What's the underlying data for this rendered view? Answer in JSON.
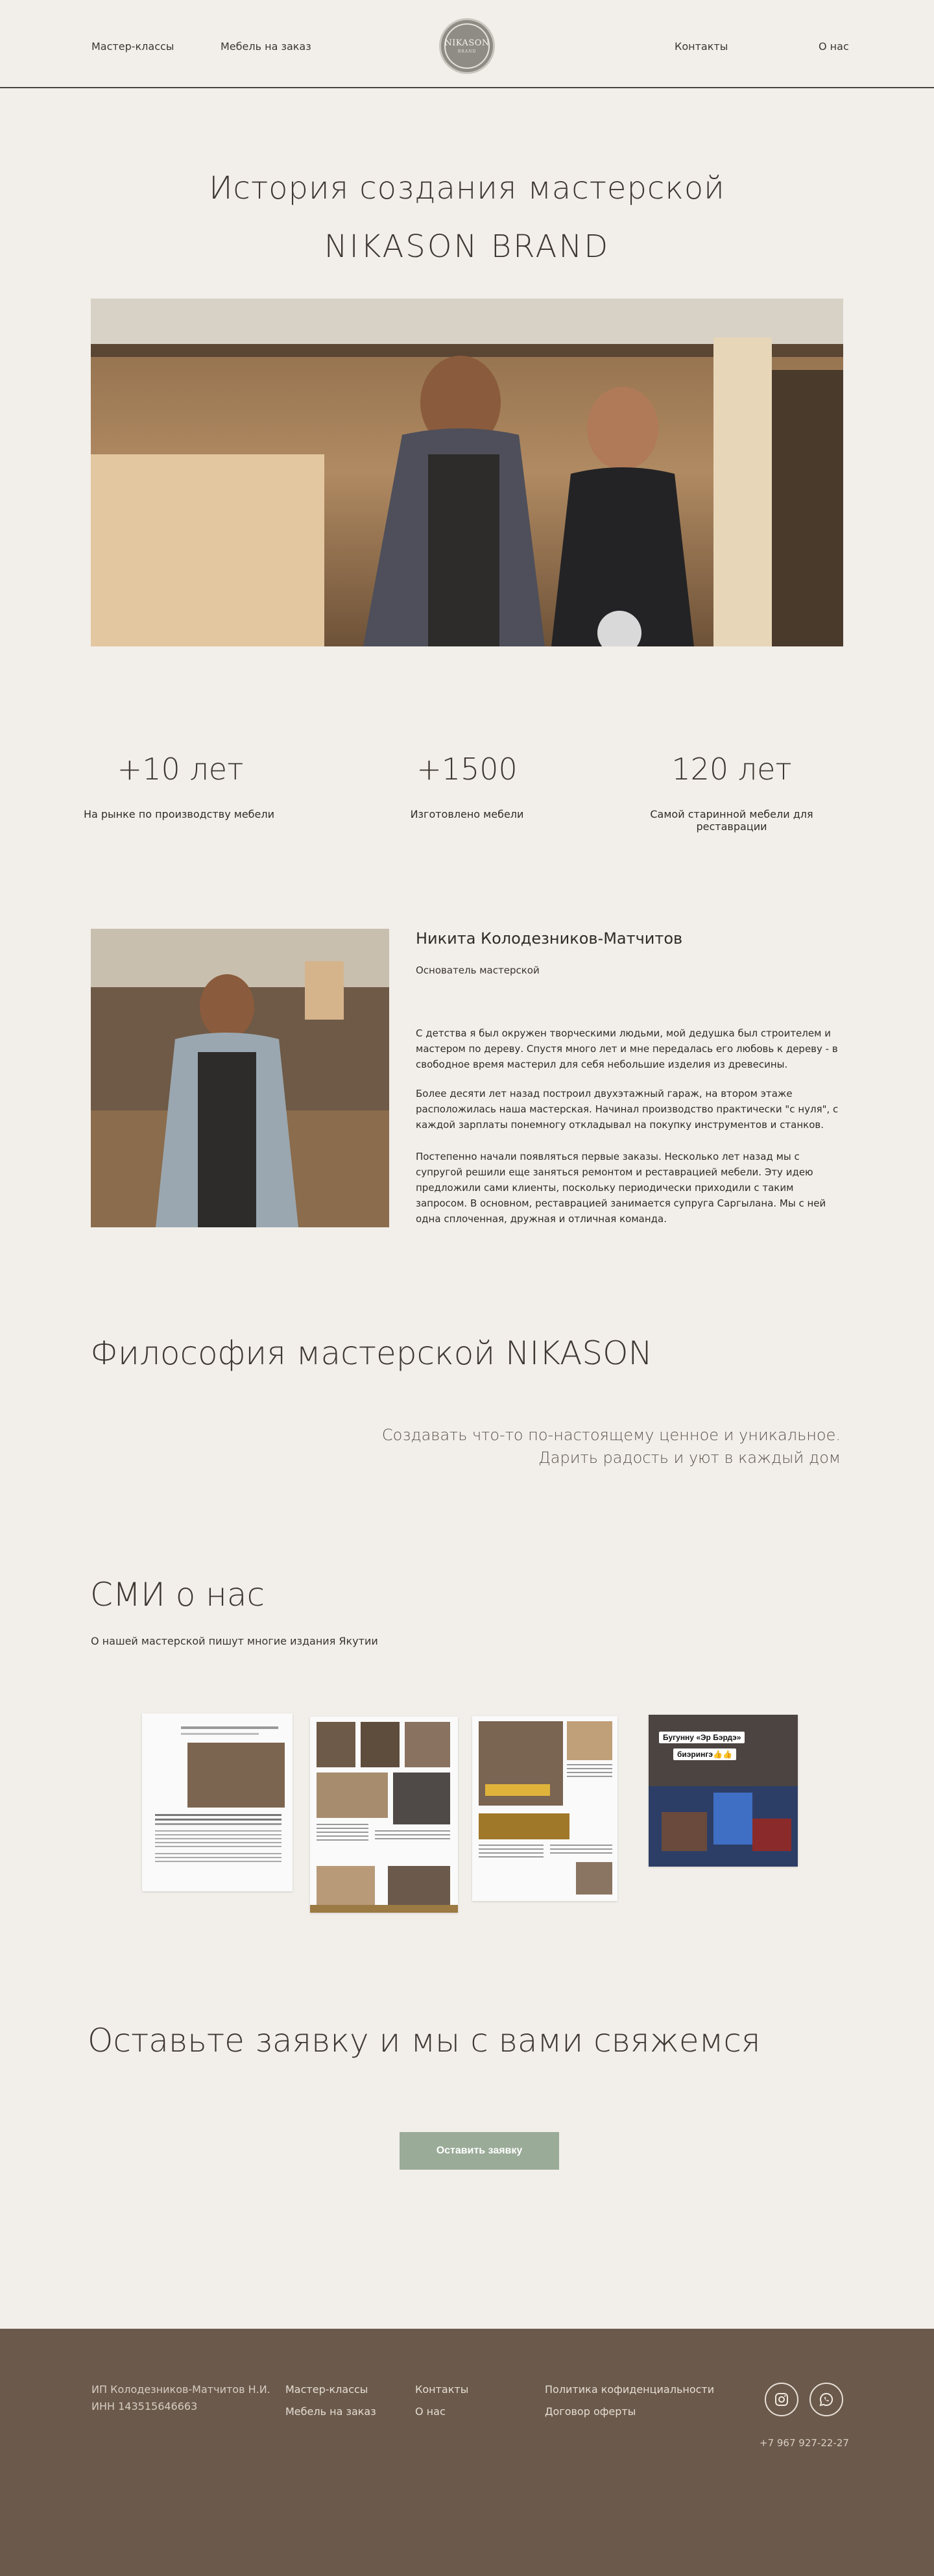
{
  "header": {
    "nav_left": [
      "Мастер-классы",
      "Мебель на заказ"
    ],
    "nav_right": [
      "Контакты",
      "О нас"
    ],
    "logo_text": "NIKASON",
    "logo_sub": "BRAND"
  },
  "hero": {
    "title_line1": "История создания мастерской",
    "title_line2": "NIKASON BRAND"
  },
  "stats": [
    {
      "value": "+10 лет",
      "caption": "На рынке по производству мебели"
    },
    {
      "value": "+1500",
      "caption": "Изготовлено мебели"
    },
    {
      "value": "120 лет",
      "caption": "Самой старинной мебели для реставрации"
    }
  ],
  "founder": {
    "name": "Никита Колодезников-Матчитов",
    "role": "Основатель мастерской",
    "paragraphs": [
      "С детства я был окружен творческими людьми, мой дедушка был строителем и мастером по дереву. Спустя много лет и мне передалась его любовь к дереву - в свободное время мастерил для себя небольшие  изделия из древесины.",
      "Более десяти лет назад построил двухэтажный гараж, на втором этаже расположилась наша мастерская. Начинал производство практически \"с нуля\", с каждой зарплаты понемногу откладывал на покупку инструментов и станков.",
      "Постепенно начали появляться первые заказы. Несколько лет назад мы с супругой решили еще заняться ремонтом и реставрацией мебели. Эту идею предложили сами клиенты, поскольку периодически приходили с таким запросом. В основном, реставрацией занимается супруга Саргылана. Мы с ней одна сплоченная, дружная и отличная команда."
    ]
  },
  "philosophy": {
    "title": "Философия мастерской NIKASON",
    "line1": "Создавать что-то по-настоящему ценное и уникальное.",
    "line2": "Дарить радость и уют в каждый дом"
  },
  "media": {
    "title": "СМИ о нас",
    "subtitle": "О нашей мастерской пишут многие издания Якутии",
    "video_caption_line1": "Бугунну «Эр Бэрдэ»",
    "video_caption_line2": "биэрингэ👍👍"
  },
  "cta": {
    "title": "Оставьте заявку и мы с вами свяжемся",
    "button": "Оставить заявку"
  },
  "footer": {
    "company": "ИП Колодезников-Матчитов Н.И.",
    "inn": "ИНН 143515646663",
    "col1": [
      "Мастер-классы",
      "Мебель на заказ"
    ],
    "col2": [
      "Контакты",
      "О нас"
    ],
    "col3": [
      "Политика кофиденциальности",
      "Договор оферты"
    ],
    "phone": "+7 967 927-22-27"
  },
  "colors": {
    "background": "#f2efea",
    "footer": "#6b5a4b",
    "button": "#9aab98"
  }
}
